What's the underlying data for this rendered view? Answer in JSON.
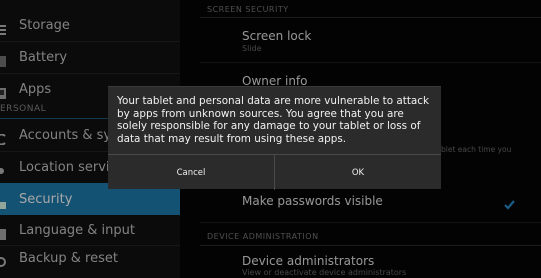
{
  "sidebar": {
    "items": [
      {
        "label": "Storage",
        "icon": "storage-icon"
      },
      {
        "label": "Battery",
        "icon": "battery-icon"
      },
      {
        "label": "Apps",
        "icon": "apps-icon"
      },
      {
        "label": "Accounts & sync",
        "icon": "sync-icon"
      },
      {
        "label": "Location services",
        "icon": "location-icon"
      },
      {
        "label": "Security",
        "icon": "lock-icon"
      },
      {
        "label": "Language & input",
        "icon": "language-icon"
      },
      {
        "label": "Backup & reset",
        "icon": "backup-icon"
      }
    ],
    "personal_header": "ERSONAL",
    "active_color": "#1f7fb3"
  },
  "main": {
    "screen_security_header": "SCREEN SECURITY",
    "screen_lock": {
      "title": "Screen lock",
      "summary": "Slide"
    },
    "owner_info": {
      "title": "Owner info"
    },
    "obscured_summary_fragment": "blet each time you",
    "make_passwords_visible": {
      "title": "Make passwords visible",
      "checked": true
    },
    "device_admin_header": "DEVICE ADMINISTRATION",
    "device_administrators": {
      "title": "Device administrators",
      "summary": "View or deactivate device administrators"
    }
  },
  "dialog": {
    "message": "Your tablet and personal data are more vulnerable to attack by apps from unknown sources. You agree that you are solely responsible for any damage to your tablet or loss of data that may result from using these apps.",
    "cancel_label": "Cancel",
    "ok_label": "OK"
  }
}
